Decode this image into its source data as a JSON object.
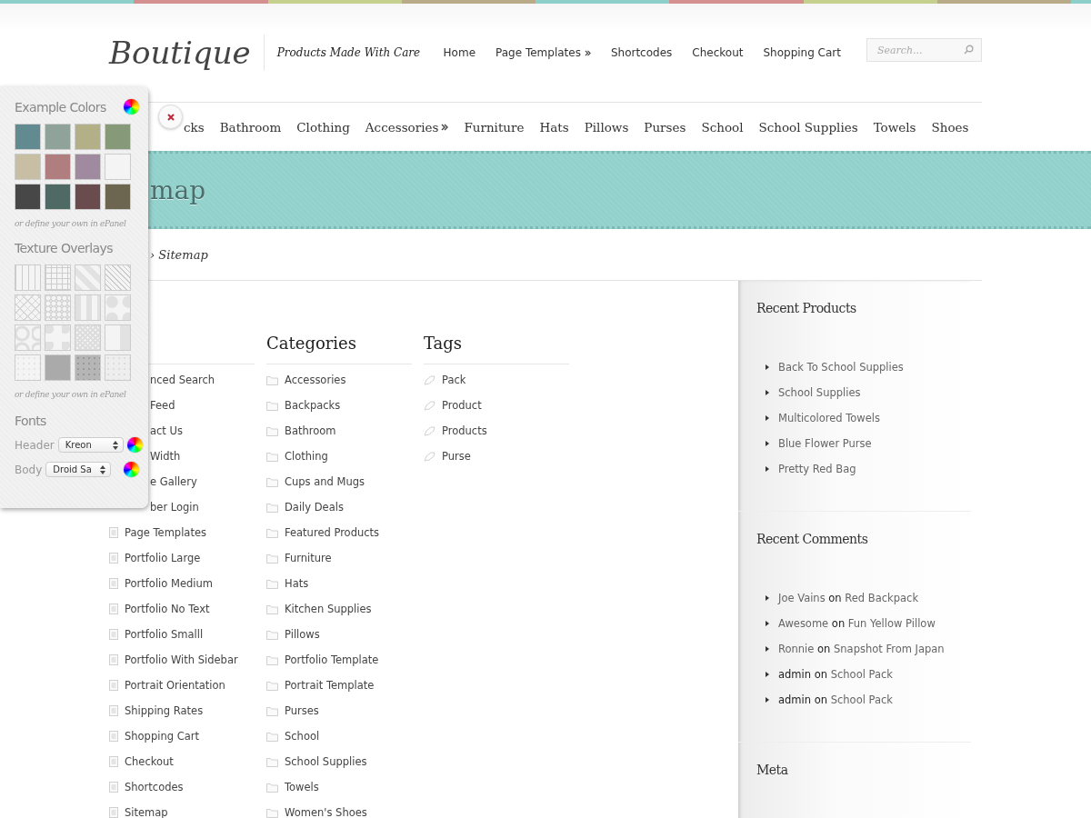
{
  "header": {
    "logo": "Boutique",
    "tagline": "Products Made With Care",
    "top_nav": [
      {
        "label": "Home",
        "has_submenu": false
      },
      {
        "label": "Page Templates",
        "has_submenu": true
      },
      {
        "label": "Shortcodes",
        "has_submenu": false
      },
      {
        "label": "Checkout",
        "has_submenu": false
      },
      {
        "label": "Shopping Cart",
        "has_submenu": false
      }
    ],
    "search": {
      "placeholder": "Search..."
    }
  },
  "category_nav": [
    {
      "label": "cks",
      "has_submenu": false
    },
    {
      "label": "Bathroom",
      "has_submenu": false
    },
    {
      "label": "Clothing",
      "has_submenu": false
    },
    {
      "label": "Accessories",
      "has_submenu": true
    },
    {
      "label": "Furniture",
      "has_submenu": false
    },
    {
      "label": "Hats",
      "has_submenu": false
    },
    {
      "label": "Pillows",
      "has_submenu": false
    },
    {
      "label": "Purses",
      "has_submenu": false
    },
    {
      "label": "School",
      "has_submenu": false
    },
    {
      "label": "School Supplies",
      "has_submenu": false
    },
    {
      "label": "Towels",
      "has_submenu": false
    },
    {
      "label": "Shoes",
      "has_submenu": false
    }
  ],
  "page_title": "map",
  "breadcrumb": "› Sitemap",
  "pages_column": {
    "covered_items": [
      "nced Search",
      "Feed",
      "act Us",
      "Width",
      "e Gallery",
      "ber Login"
    ],
    "items": [
      "Page Templates",
      "Portfolio Large",
      "Portfolio Medium",
      "Portfolio No Text",
      "Portfolio Smalll",
      "Portfolio With Sidebar",
      "Portrait Orientation",
      "Shipping Rates",
      "Shopping Cart",
      "Checkout",
      "Shortcodes",
      "Sitemap"
    ]
  },
  "categories_column": {
    "title": "Categories",
    "items": [
      "Accessories",
      "Backpacks",
      "Bathroom",
      "Clothing",
      "Cups and Mugs",
      "Daily Deals",
      "Featured Products",
      "Furniture",
      "Hats",
      "Kitchen Supplies",
      "Pillows",
      "Portfolio Template",
      "Portrait Template",
      "Purses",
      "School",
      "School Supplies",
      "Towels",
      "Women's Shoes"
    ]
  },
  "tags_column": {
    "title": "Tags",
    "items": [
      "Pack",
      "Product",
      "Products",
      "Purse"
    ]
  },
  "sidebar": {
    "recent_products": {
      "title": "Recent Products",
      "items": [
        "Back To School Supplies",
        "School Supplies",
        "Multicolored Towels",
        "Blue Flower Purse",
        "Pretty Red Bag"
      ]
    },
    "recent_comments": {
      "title": "Recent Comments",
      "items": [
        {
          "author": "Joe Vains",
          "author_linked": true,
          "connector": "on",
          "post": "Red Backpack"
        },
        {
          "author": "Awesome",
          "author_linked": true,
          "connector": "on",
          "post": "Fun Yellow Pillow"
        },
        {
          "author": "Ronnie",
          "author_linked": true,
          "connector": "on",
          "post": "Snapshot From Japan"
        },
        {
          "author": "admin",
          "author_linked": false,
          "connector": "on",
          "post": "School Pack"
        },
        {
          "author": "admin",
          "author_linked": false,
          "connector": "on",
          "post": "School Pack"
        }
      ]
    },
    "meta": {
      "title": "Meta"
    }
  },
  "style_panel": {
    "colors_title": "Example Colors",
    "swatches": [
      {
        "color": "#628a91"
      },
      {
        "color": "#8fa39a"
      },
      {
        "color": "#b3b087"
      },
      {
        "color": "#869a79"
      },
      {
        "color": "#c8bea3"
      },
      {
        "color": "#b07e7e"
      },
      {
        "color": "#a08aa0"
      },
      {
        "color": "#f4f4f4"
      },
      {
        "color": "#474747"
      },
      {
        "color": "#4f6a64"
      },
      {
        "color": "#6a4c4f"
      },
      {
        "color": "#6c6651"
      }
    ],
    "colors_note": "or define your own in ePanel",
    "textures_title": "Texture Overlays",
    "textures_note": "or define your own in ePanel",
    "fonts_title": "Fonts",
    "font_rows": [
      {
        "label": "Header",
        "value": "Kreon"
      },
      {
        "label": "Body",
        "value": "Droid Sa"
      }
    ]
  }
}
